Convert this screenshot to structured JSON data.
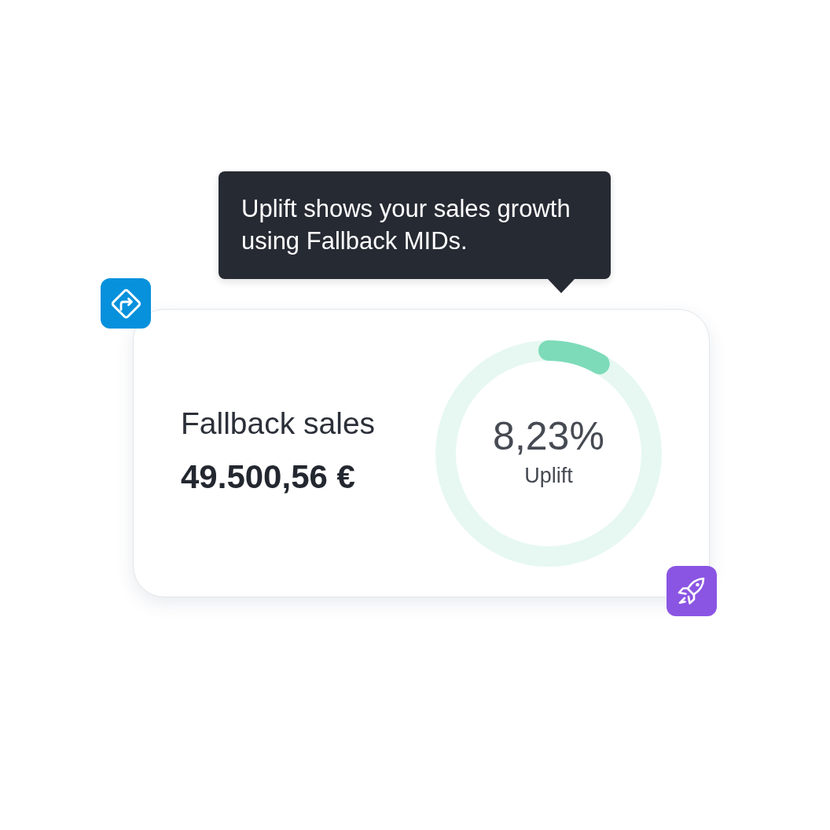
{
  "tooltip": {
    "text": "Uplift shows your sales growth using Fallback MIDs."
  },
  "card": {
    "label": "Fallback sales",
    "amount": "49.500,56 €",
    "uplift": {
      "value": "8,23%",
      "label": "Uplift",
      "level": 0.0823
    }
  }
}
